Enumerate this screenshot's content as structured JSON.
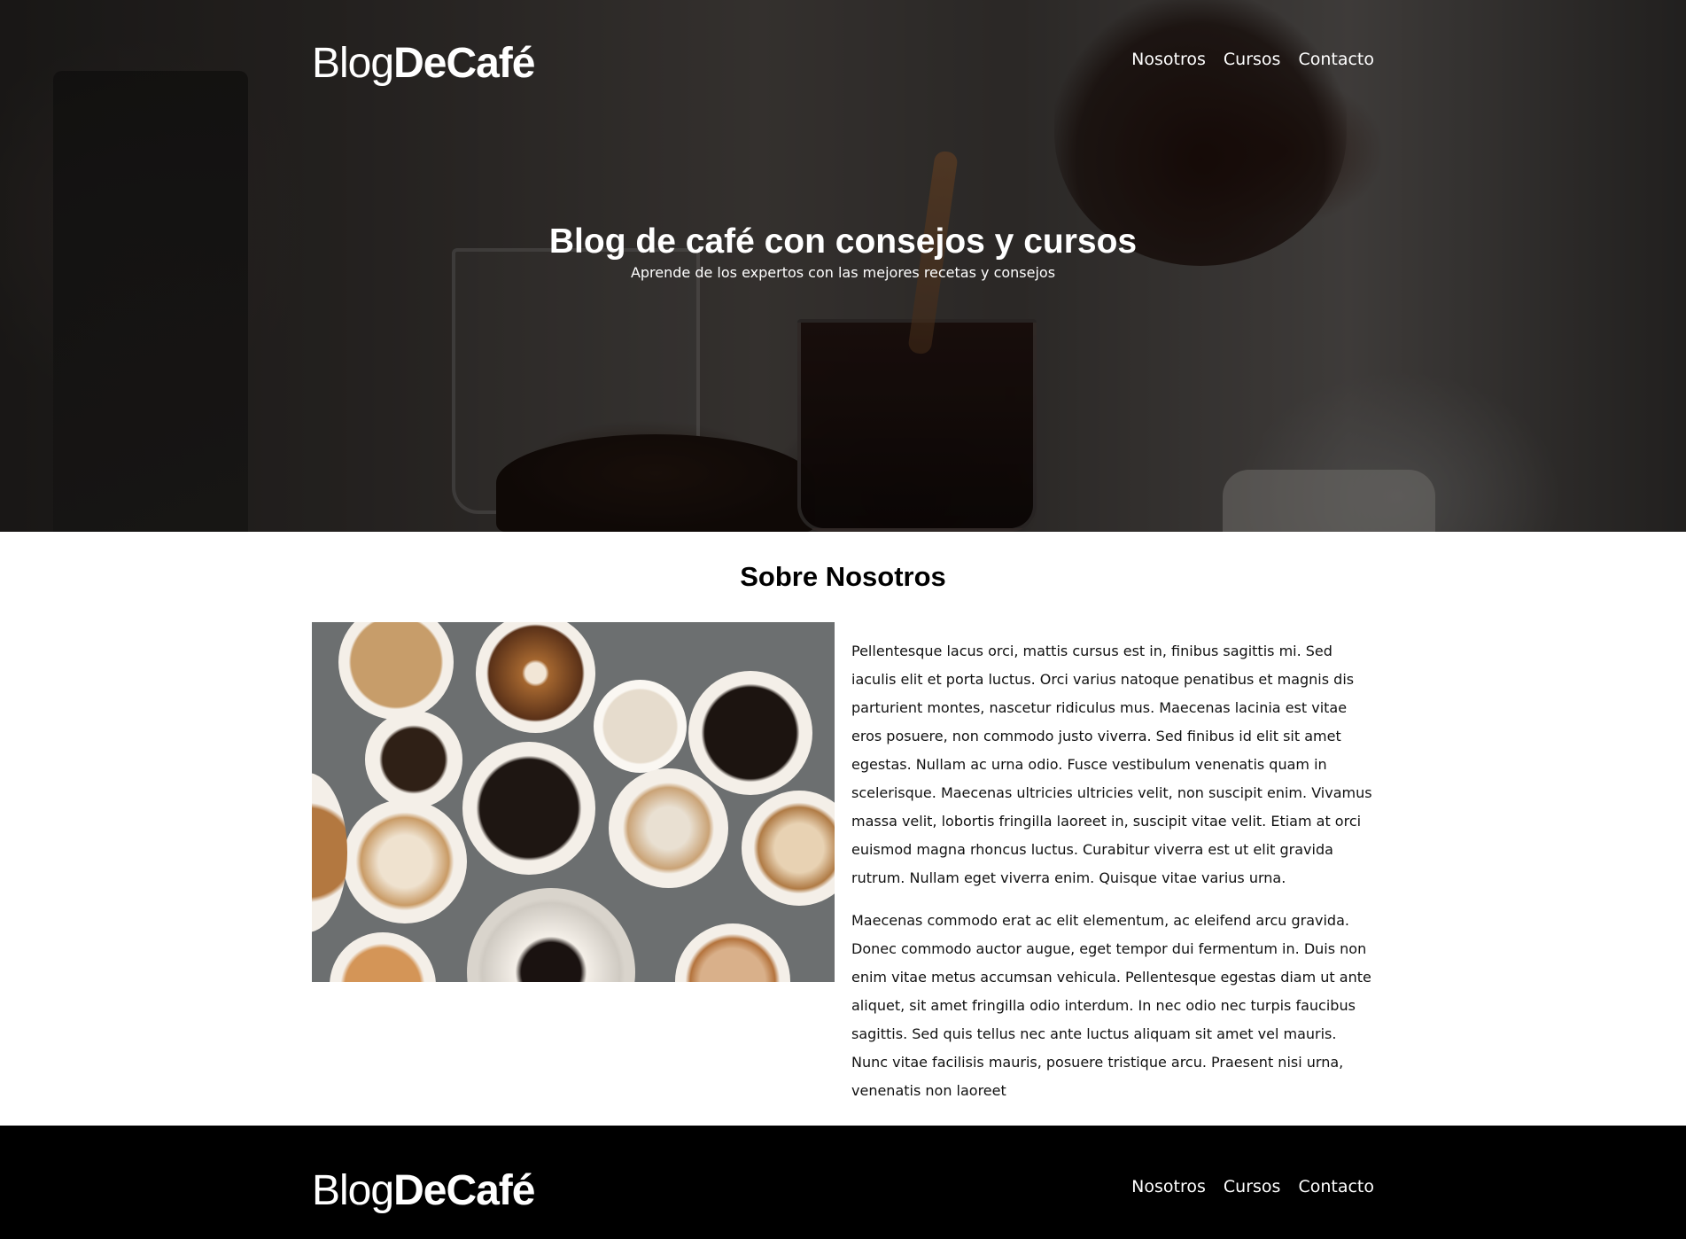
{
  "header": {
    "logo_part1": "Blog",
    "logo_part2": "DeCafé",
    "nav": [
      "Nosotros",
      "Cursos",
      "Contacto"
    ]
  },
  "hero": {
    "title": "Blog de café con consejos y cursos",
    "subtitle": "Aprende de los expertos con las mejores recetas y consejos"
  },
  "about": {
    "title": "Sobre Nosotros",
    "paragraphs": [
      "Pellentesque lacus orci, mattis cursus est in, finibus sagittis mi. Sed iaculis elit et porta luctus. Orci varius natoque penatibus et magnis dis parturient montes, nascetur ridiculus mus. Maecenas lacinia est vitae eros posuere, non commodo justo viverra. Sed finibus id elit sit amet egestas. Nullam ac urna odio. Fusce vestibulum venenatis quam in scelerisque. Maecenas ultricies ultricies velit, non suscipit enim. Vivamus massa velit, lobortis fringilla laoreet in, suscipit vitae velit. Etiam at orci euismod magna rhoncus luctus. Curabitur viverra est ut elit gravida rutrum. Nullam eget viverra enim. Quisque vitae varius urna.",
      "Maecenas commodo erat ac elit elementum, ac eleifend arcu gravida. Donec commodo auctor augue, eget tempor dui fermentum in. Duis non enim vitae metus accumsan vehicula. Pellentesque egestas diam ut ante aliquet, sit amet fringilla odio interdum. In nec odio nec turpis faucibus sagittis. Sed quis tellus nec ante luctus aliquam sit amet vel mauris. Nunc vitae facilisis mauris, posuere tristique arcu. Praesent nisi urna, venenatis non laoreet"
    ]
  },
  "footer": {
    "logo_part1": "Blog",
    "logo_part2": "DeCafé",
    "nav": [
      "Nosotros",
      "Cursos",
      "Contacto"
    ]
  },
  "colors": {
    "footer_bg": "#000000",
    "text_light": "#ffffff",
    "text_dark": "#111111"
  }
}
